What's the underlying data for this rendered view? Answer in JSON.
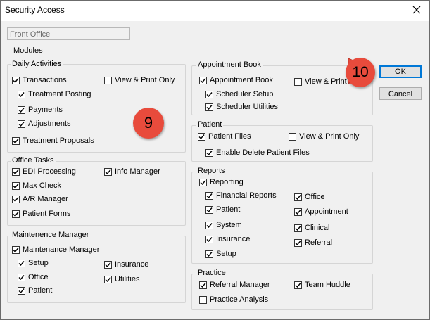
{
  "window": {
    "title": "Security Access"
  },
  "readonly_field": {
    "value": "Front Office"
  },
  "modules_label": "Modules",
  "groups": {
    "daily_activities": {
      "legend": "Daily Activities",
      "items": [
        {
          "label": "Transactions",
          "checked": true
        },
        {
          "label": "View & Print Only",
          "checked": false
        },
        {
          "label": "Treatment Posting",
          "checked": true
        },
        {
          "label": "Payments",
          "checked": true
        },
        {
          "label": "Adjustments",
          "checked": true
        },
        {
          "label": "Treatment Proposals",
          "checked": true
        }
      ]
    },
    "office_tasks": {
      "legend": "Office Tasks",
      "items": [
        {
          "label": "EDI Processing",
          "checked": true
        },
        {
          "label": "Info Manager",
          "checked": true
        },
        {
          "label": "Max Check",
          "checked": true
        },
        {
          "label": "A/R Manager",
          "checked": true
        },
        {
          "label": "Patient Forms",
          "checked": true
        }
      ]
    },
    "maintenance_manager": {
      "legend": "Maintenence Manager",
      "items": [
        {
          "label": "Maintenance Manager",
          "checked": true
        },
        {
          "label": "Setup",
          "checked": true
        },
        {
          "label": "Office",
          "checked": true
        },
        {
          "label": "Patient",
          "checked": true
        },
        {
          "label": "Insurance",
          "checked": true
        },
        {
          "label": "Utilities",
          "checked": true
        }
      ]
    },
    "appointment_book": {
      "legend": "Appointment Book",
      "items": [
        {
          "label": "Appointment Book",
          "checked": true
        },
        {
          "label": "View & Print O",
          "checked": false
        },
        {
          "label": "Scheduler Setup",
          "checked": true
        },
        {
          "label": "Scheduler Utilities",
          "checked": true
        }
      ]
    },
    "patient": {
      "legend": "Patient",
      "items": [
        {
          "label": "Patient Files",
          "checked": true
        },
        {
          "label": "View & Print Only",
          "checked": false
        },
        {
          "label": "Enable Delete Patient Files",
          "checked": true
        }
      ]
    },
    "reports": {
      "legend": "Reports",
      "items": [
        {
          "label": "Reporting",
          "checked": true
        },
        {
          "label": "Financial Reports",
          "checked": true
        },
        {
          "label": "Patient",
          "checked": true
        },
        {
          "label": "System",
          "checked": true
        },
        {
          "label": "Insurance",
          "checked": true
        },
        {
          "label": "Setup",
          "checked": true
        },
        {
          "label": "Office",
          "checked": true
        },
        {
          "label": "Appointment",
          "checked": true
        },
        {
          "label": "Clinical",
          "checked": true
        },
        {
          "label": "Referral",
          "checked": true
        }
      ]
    },
    "practice": {
      "legend": "Practice",
      "items": [
        {
          "label": "Referral Manager",
          "checked": true
        },
        {
          "label": "Team Huddle",
          "checked": true
        },
        {
          "label": "Practice Analysis",
          "checked": false
        }
      ]
    }
  },
  "buttons": {
    "ok": "OK",
    "cancel": "Cancel"
  },
  "annotations": {
    "step9": "9",
    "step10": "10"
  },
  "colors": {
    "badge": "#e84b3c",
    "default_button_border": "#0078d7"
  }
}
